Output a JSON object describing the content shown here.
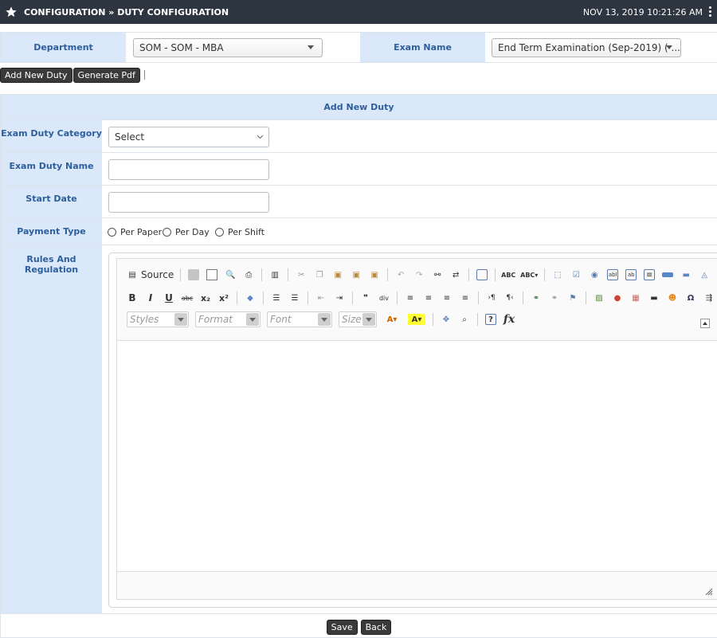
{
  "header": {
    "title": "CONFIGURATION » DUTY CONFIGURATION",
    "datetime": "NOV 13, 2019  10:21:26 AM"
  },
  "filters": {
    "department_label": "Department",
    "department_value": "SOM - SOM - MBA",
    "exam_label": "Exam Name",
    "exam_value": "End Term Examination (Sep-2019) ( ..."
  },
  "actions": {
    "add_new_duty": "Add New Duty",
    "generate_pdf": "Generate Pdf"
  },
  "form": {
    "heading": "Add New Duty",
    "category_label": "Exam Duty Category",
    "category_value": "Select",
    "name_label": "Exam Duty Name",
    "start_date_label": "Start Date",
    "payment_label": "Payment Type",
    "payment_options": [
      "Per Paper",
      "Per Day",
      "Per Shift"
    ],
    "rules_label": "Rules And Regulation"
  },
  "editor": {
    "source_label": "Source",
    "styles_placeholder": "Styles",
    "format_placeholder": "Format",
    "font_placeholder": "Font",
    "size_placeholder": "Size"
  },
  "footer": {
    "save": "Save",
    "back": "Back"
  }
}
